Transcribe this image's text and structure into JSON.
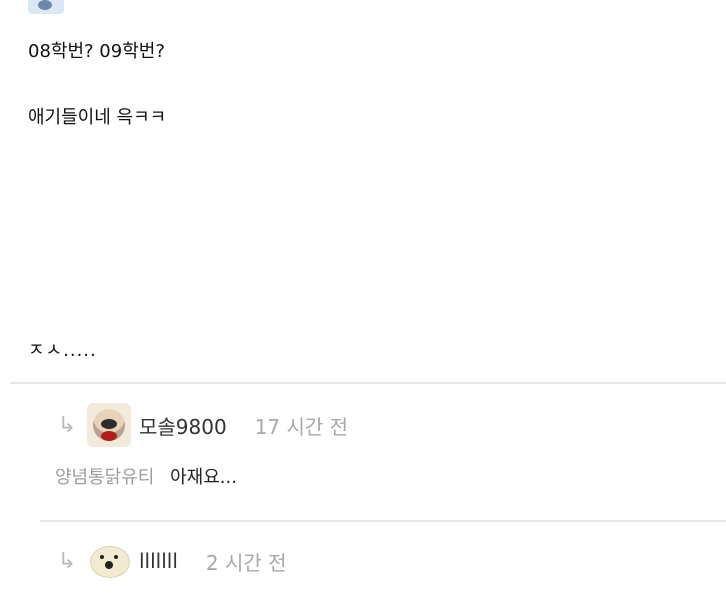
{
  "post": {
    "line1": "08학번? 09학번?",
    "line2": "애기들이네 윽ㅋㅋ",
    "line3": "ㅈㅅ....."
  },
  "replies": [
    {
      "name": "모솔9800",
      "time": "17 시간 전",
      "mention": "양념통닭유티",
      "text": "아재요..."
    },
    {
      "name": "lllllll",
      "time": "2 시간 전"
    }
  ],
  "colors": {
    "muted": "#a8a8a8",
    "divider": "#e7e7e7",
    "text": "#222222"
  },
  "icons": {
    "reply": "reply-arrow-icon"
  }
}
